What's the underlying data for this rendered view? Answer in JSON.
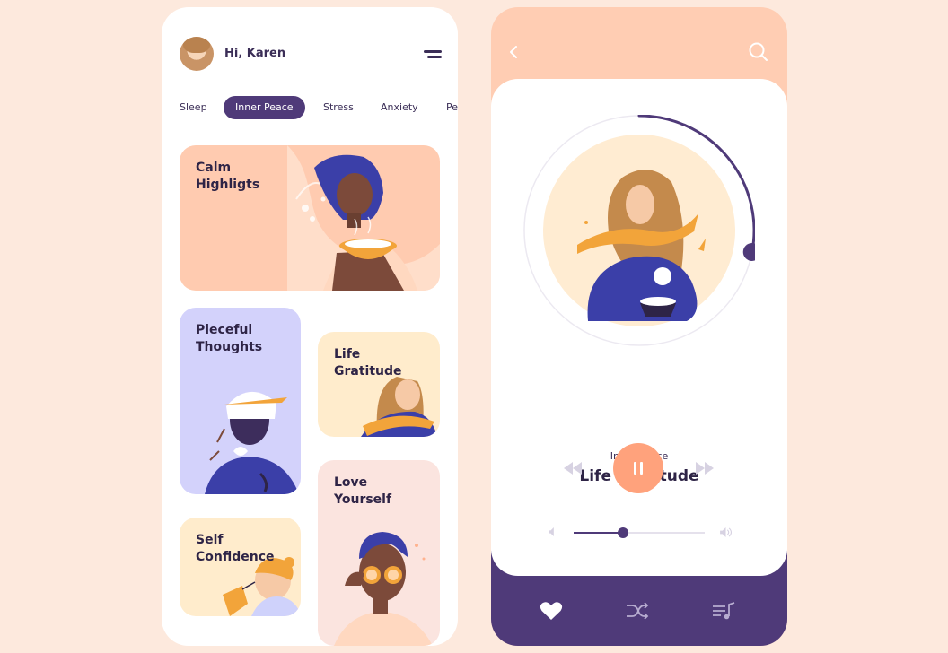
{
  "colors": {
    "background": "#fde9dd",
    "primary": "#4f3a79",
    "accent": "#ffa27c",
    "peach": "#ffcdb3",
    "text_dark": "#2e2446"
  },
  "left": {
    "greeting": "Hi, Karen",
    "avatar_icon": "user-avatar",
    "menu_icon": "hamburger-menu-icon",
    "tabs": [
      {
        "label": "Sleep",
        "active": false
      },
      {
        "label": "Inner Peace",
        "active": true
      },
      {
        "label": "Stress",
        "active": false
      },
      {
        "label": "Anxiety",
        "active": false
      },
      {
        "label": "Pe",
        "active": false
      }
    ],
    "cards": [
      {
        "title": "Calm\nHighligts",
        "color": "#ffcbb0"
      },
      {
        "title": "Pieceful\nThoughts",
        "color": "#d3d2fb"
      },
      {
        "title": "Life\nGratitude",
        "color": "#ffeccc"
      },
      {
        "title": "Self\nConfidence",
        "color": "#ffeccc"
      },
      {
        "title": "Love\nYourself",
        "color": "#fbe4df"
      }
    ]
  },
  "right": {
    "back_icon": "chevron-left-icon",
    "search_icon": "search-icon",
    "category": "Inner Peace",
    "track_title": "Life Gratitude",
    "progress": 0.28,
    "volume": 0.38,
    "controls": {
      "rewind": "rewind-icon",
      "pause": "pause-icon",
      "forward": "fast-forward-icon"
    },
    "nav": [
      "heart-icon",
      "shuffle-icon",
      "playlist-icon"
    ]
  }
}
